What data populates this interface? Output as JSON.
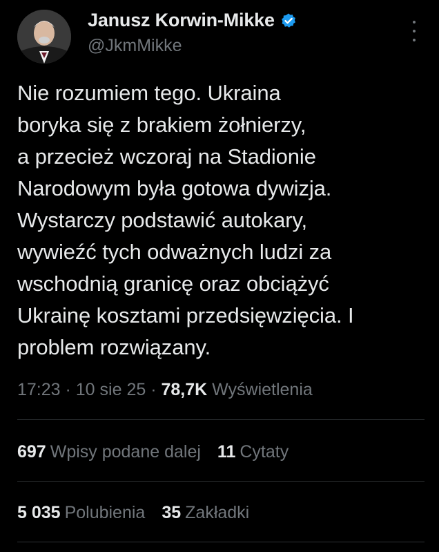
{
  "author": {
    "display_name": "Janusz Korwin-Mikke",
    "handle": "@JkmMikke",
    "verified": true
  },
  "tweet": {
    "text": "Nie rozumiem tego. Ukraina\nboryka się z brakiem żołnierzy,\na przecież wczoraj na Stadionie\nNarodowym była gotowa dywizja.\nWystarczy podstawić autokary,\nwywieźć tych odważnych ludzi za\nwschodnią granicę oraz obciążyć\nUkrainę kosztami przedsięwzięcia. I\nproblem rozwiązany."
  },
  "meta": {
    "time": "17:23",
    "sep1": " · ",
    "date": "10 sie 25",
    "sep2": " · ",
    "views_count": "78,7K",
    "views_label": "Wyświetlenia"
  },
  "stats": {
    "reposts_count": "697",
    "reposts_label": "Wpisy podane dalej",
    "quotes_count": "11",
    "quotes_label": "Cytaty",
    "likes_count": "5 035",
    "likes_label": "Polubienia",
    "bookmarks_count": "35",
    "bookmarks_label": "Zakładki"
  },
  "icons": {
    "verified": "verified-badge-icon",
    "more": "more-options-icon"
  },
  "colors": {
    "background": "#000000",
    "text": "#e7e9ea",
    "secondary": "#71767b",
    "verified": "#1d9bf0",
    "divider": "#2f3336"
  }
}
